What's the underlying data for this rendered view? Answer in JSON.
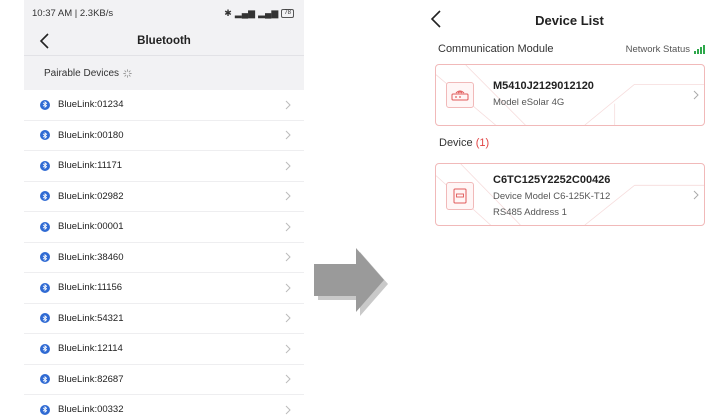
{
  "left": {
    "status_bar": {
      "time_speed": "10:37 AM | 2.3KB/s",
      "battery": "78"
    },
    "nav": {
      "title": "Bluetooth"
    },
    "section_title": "Pairable Devices",
    "devices": [
      "BlueLink:01234",
      "BlueLink:00180",
      "BlueLink:11171",
      "BlueLink:02982",
      "BlueLink:00001",
      "BlueLink:38460",
      "BlueLink:11156",
      "BlueLink:54321",
      "BlueLink:12114",
      "BlueLink:82687",
      "BlueLink:00332"
    ]
  },
  "right": {
    "nav": {
      "title": "Device List"
    },
    "comm_section": {
      "title": "Communication Module",
      "network_status_label": "Network Status"
    },
    "module_card": {
      "serial": "M5410J2129012120",
      "model_label": "Model",
      "model_value": "eSolar 4G"
    },
    "device_section": {
      "title": "Device",
      "count": "(1)"
    },
    "device_card": {
      "serial": "C6TC125Y2252C00426",
      "model_label": "Device Model",
      "model_value": "C6-125K-T12",
      "address_label": "RS485 Address",
      "address_value": "1"
    }
  },
  "colors": {
    "bluetooth_blue": "#2f6ad3",
    "card_border": "#f1b9b9",
    "signal_green": "#2ea84b",
    "count_red": "#e04343"
  },
  "icons": [
    "back-arrow-icon",
    "bluetooth-icon",
    "chevron-right-icon",
    "loading-spinner-icon",
    "gateway-icon",
    "inverter-icon",
    "signal-icon",
    "transition-arrow-icon"
  ]
}
